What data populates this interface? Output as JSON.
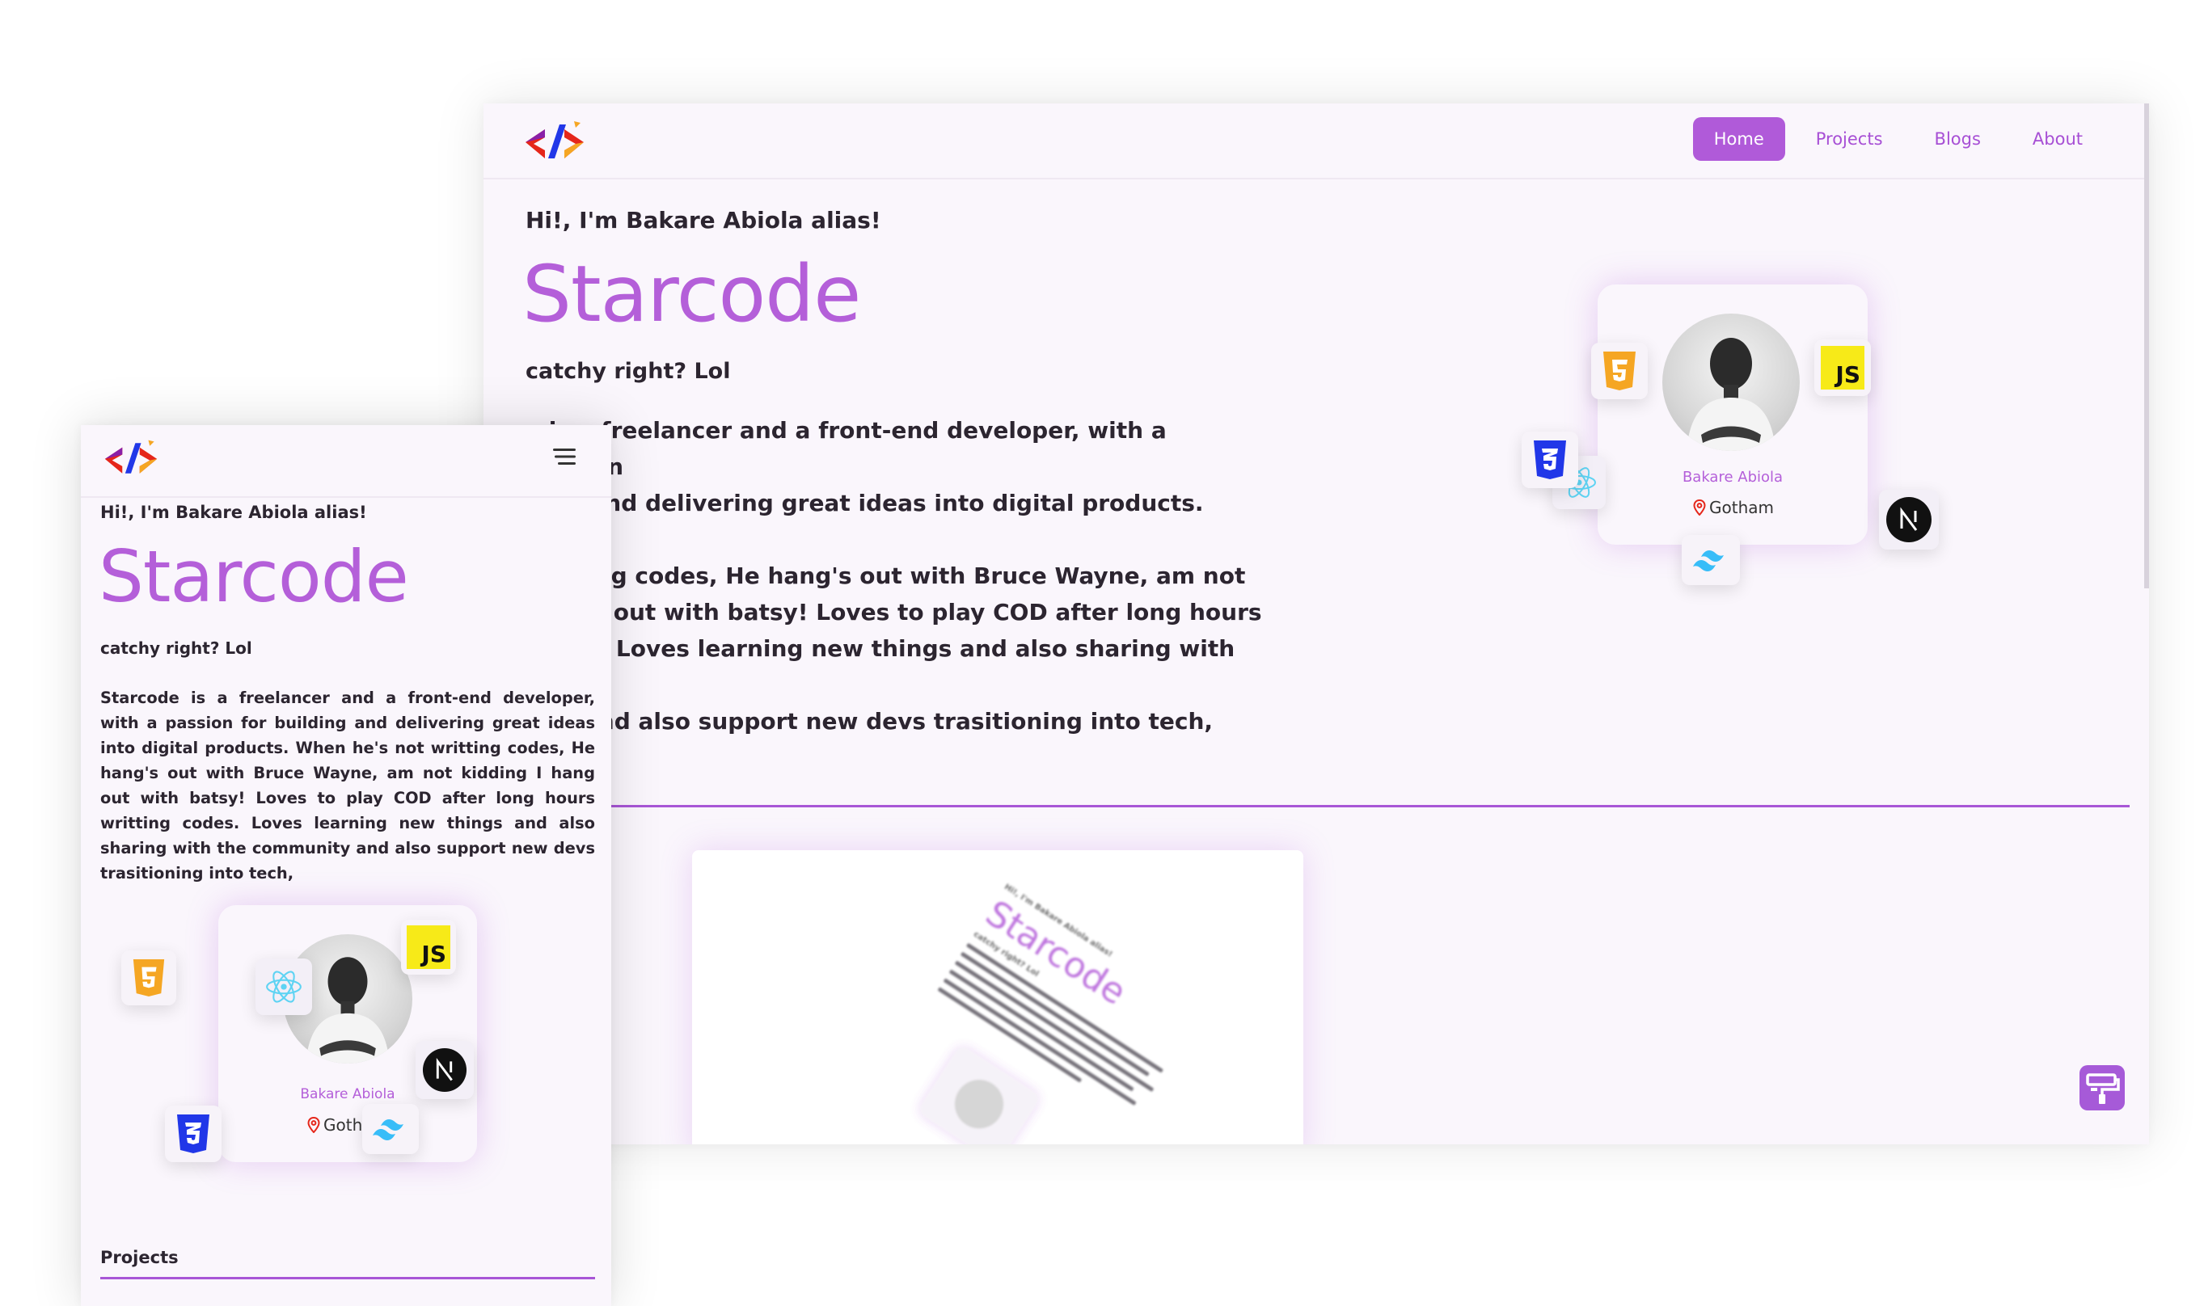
{
  "desktop": {
    "nav": {
      "items": [
        {
          "label": "Home",
          "active": true
        },
        {
          "label": "Projects",
          "active": false
        },
        {
          "label": "Blogs",
          "active": false
        },
        {
          "label": "About",
          "active": false
        }
      ]
    },
    "hero": {
      "greeting": "Hi!, I'm Bakare Abiola alias!",
      "title": "Starcode",
      "tagline": "catchy right? Lol",
      "lines": [
        "e is a freelancer and a front-end developer, with a passion",
        "ding and delivering great ideas into digital products. When",
        "writting codes, He hang's out with Bruce Wayne, am not",
        "I hang out with batsy! Loves to play COD after long hours",
        "codes. Loves learning new things and also sharing with the",
        "nity and also support new devs trasitioning into tech,"
      ]
    },
    "card": {
      "name": "Bakare Abiola",
      "location": "Gotham"
    },
    "preview": {
      "greeting": "Hi!, I'm Bakare Abiola alias!",
      "title": "Starcode",
      "tagline": "catchy right? Lol"
    }
  },
  "mobile": {
    "hero": {
      "greeting": "Hi!, I'm Bakare Abiola alias!",
      "title": "Starcode",
      "tagline": "catchy right? Lol",
      "description": "Starcode is a freelancer and a front-end developer, with a passion for building and delivering great ideas into digital products. When he's not writting codes, He hang's out with Bruce Wayne, am not kidding I hang out with batsy! Loves to play COD after long hours writting codes. Loves learning new things and also sharing with the community and also support new devs trasitioning into tech,"
    },
    "card": {
      "name": "Bakare Abiola",
      "location": "Goth"
    },
    "projects_heading": "Projects"
  },
  "icons": {
    "logo": "code-brackets-logo",
    "html": "html5-icon",
    "css": "css3-icon",
    "js": "javascript-icon",
    "react": "react-icon",
    "next": "nextjs-icon",
    "tailwind": "tailwind-icon",
    "location": "location-pin-icon",
    "menu": "hamburger-menu-icon",
    "fab": "paint-roller-icon"
  },
  "colors": {
    "accent": "#b05ad9",
    "background": "#faf6fc",
    "text": "#2c2530",
    "html_orange": "#f5a623",
    "css_blue": "#2137e8",
    "js_yellow": "#f7ea18",
    "react_cyan": "#5ed3f3",
    "tailwind_cyan": "#38bdf8"
  }
}
